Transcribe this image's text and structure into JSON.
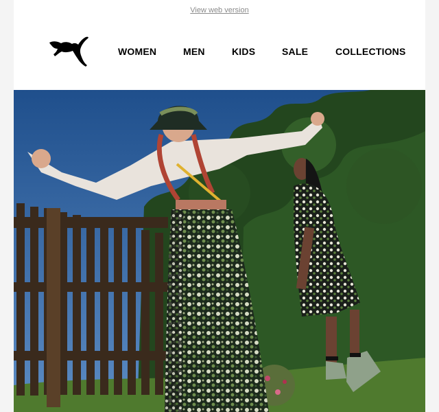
{
  "topbar": {
    "view_web_version": "View web version"
  },
  "brand": {
    "logo_icon": "puma-cat-logo"
  },
  "nav": {
    "women": "WOMEN",
    "men": "MEN",
    "kids": "KIDS",
    "sale": "SALE",
    "collections": "COLLECTIONS"
  },
  "hero": {
    "image": "fashion-photo-two-women-floral-skirts-garden-fence"
  },
  "colors": {
    "text": "#000000",
    "link": "#8a8a8a",
    "background": "#ffffff",
    "page": "#f4f4f4"
  }
}
